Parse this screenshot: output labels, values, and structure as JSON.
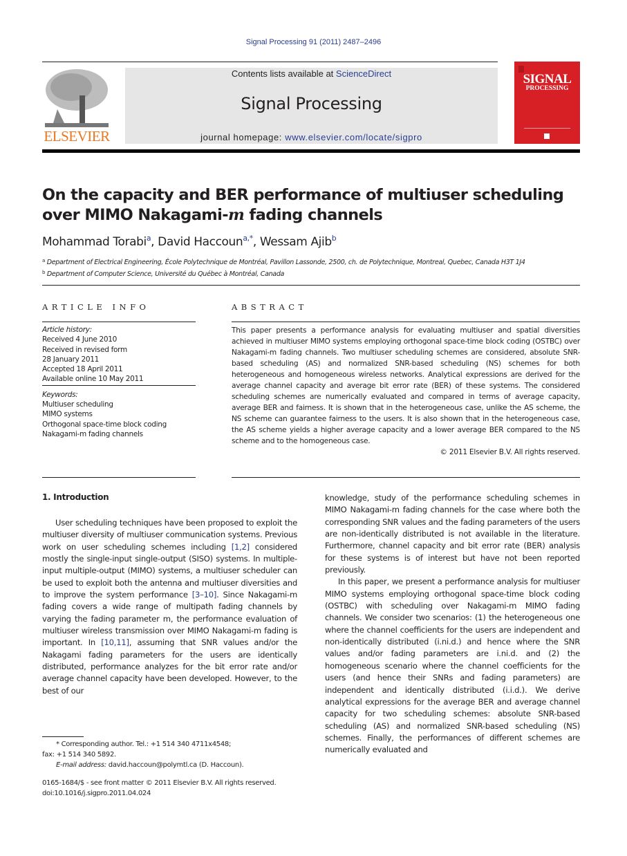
{
  "header": {
    "running_head": "Signal Processing 91 (2011) 2487–2496",
    "contents_prefix": "Contents lists available at ",
    "contents_link": "ScienceDirect",
    "journal_title": "Signal Processing",
    "homepage_prefix": "journal homepage: ",
    "homepage_link": "www.elsevier.com/locate/sigpro",
    "publisher_logo": "ELSEVIER",
    "cover_title": "SIGNAL",
    "cover_subtitle": "PROCESSING"
  },
  "article": {
    "title_part1": "On the capacity and BER performance of multiuser scheduling over MIMO Nakagami-",
    "title_italic": "m",
    "title_part2": " fading channels",
    "authors": [
      {
        "name": "Mohammad Torabi",
        "sup": "a"
      },
      {
        "name": "David Haccoun",
        "sup": "a,*"
      },
      {
        "name": "Wessam Ajib",
        "sup": "b"
      }
    ],
    "affiliations": [
      {
        "mark": "a",
        "text": "Department of Electrical Engineering, École Polytechnique de Montréal, Pavillon Lassonde, 2500, ch. de Polytechnique, Montreal, Quebec, Canada H3T 1J4"
      },
      {
        "mark": "b",
        "text": "Department of Computer Science, Université du Québec à Montréal, Canada"
      }
    ]
  },
  "article_info": {
    "heading": "ARTICLE INFO",
    "history_label": "Article history:",
    "history": [
      "Received 4 June 2010",
      "Received in revised form",
      "28 January 2011",
      "Accepted 18 April 2011",
      "Available online 10 May 2011"
    ],
    "keywords_label": "Keywords:",
    "keywords": [
      "Multiuser scheduling",
      "MIMO systems",
      "Orthogonal space-time block coding",
      "Nakagami-m fading channels"
    ]
  },
  "abstract": {
    "heading": "ABSTRACT",
    "text": "This paper presents a performance analysis for evaluating multiuser and spatial diversities achieved in multiuser MIMO systems employing orthogonal space-time block coding (OSTBC) over Nakagami-m fading channels. Two multiuser scheduling schemes are considered, absolute SNR-based scheduling (AS) and normalized SNR-based scheduling (NS) schemes for both heterogeneous and homogeneous wireless networks. Analytical expressions are derived for the average channel capacity and average bit error rate (BER) of these systems. The considered scheduling schemes are numerically evaluated and compared in terms of average capacity, average BER and fairness. It is shown that in the heterogeneous case, unlike the AS scheme, the NS scheme can guarantee fairness to the users. It is also shown that in the heterogeneous case, the AS scheme yields a higher average capacity and a lower average BER compared to the NS scheme and to the homogeneous case.",
    "copyright": "© 2011 Elsevier B.V. All rights reserved."
  },
  "body": {
    "section_heading": "1.  Introduction",
    "left_p1_a": "User scheduling techniques have been proposed to exploit the multiuser diversity of multiuser communication systems. Previous work on user scheduling schemes including ",
    "ref_1": "[1,2]",
    "left_p1_b": " considered mostly the single-input single-output (SISO) systems. In multiple-input multiple-output (MIMO) systems, a multiuser scheduler can be used to exploit both the antenna and multiuser diversities and to improve the system performance ",
    "ref_2": "[3–10]",
    "left_p1_c": ". Since Nakagami-m fading covers a wide range of multipath fading channels by varying the fading parameter m, the performance evaluation of multiuser wireless transmission over MIMO Nakagami-m fading is important. In ",
    "ref_3": "[10,11]",
    "left_p1_d": ", assuming that SNR values and/or the Nakagami fading parameters for the users are identically distributed, performance analyzes for the bit error rate and/or average channel capacity have been developed. However, to the best of our",
    "right_p1": "knowledge, study of the performance scheduling schemes in MIMO Nakagami-m fading channels for the case where both the corresponding SNR values and the fading parameters of the users are non-identically distributed is not available in the literature. Furthermore, channel capacity and bit error rate (BER) analysis for these systems is of interest but have not been reported previously.",
    "right_p2": "In this paper, we present a performance analysis for multiuser MIMO systems employing orthogonal space-time block coding (OSTBC) with scheduling over Nakagami-m MIMO fading channels. We consider two scenarios: (1) the heterogeneous one where the channel coefficients for the users are independent and non-identically distributed (i.ni.d.) and hence where the SNR values and/or fading parameters are i.ni.d. and (2) the homogeneous scenario where the channel coefficients for the users (and hence their SNRs and fading parameters) are independent and identically distributed (i.i.d.). We derive analytical expressions for the average BER and average channel capacity for two scheduling schemes: absolute SNR-based scheduling (AS) and normalized SNR-based scheduling (NS) schemes. Finally, the performances of different schemes are numerically evaluated and"
  },
  "footnote": {
    "line1": "* Corresponding author. Tel.: +1 514 340 4711x4548;",
    "line2": "fax: +1 514 340 5892.",
    "email_label": "E-mail address:",
    "email": " david.haccoun@polymtl.ca (D. Haccoun).",
    "front_matter": "0165-1684/$ - see front matter © 2011 Elsevier B.V. All rights reserved.",
    "doi": "doi:10.1016/j.sigpro.2011.04.024"
  }
}
